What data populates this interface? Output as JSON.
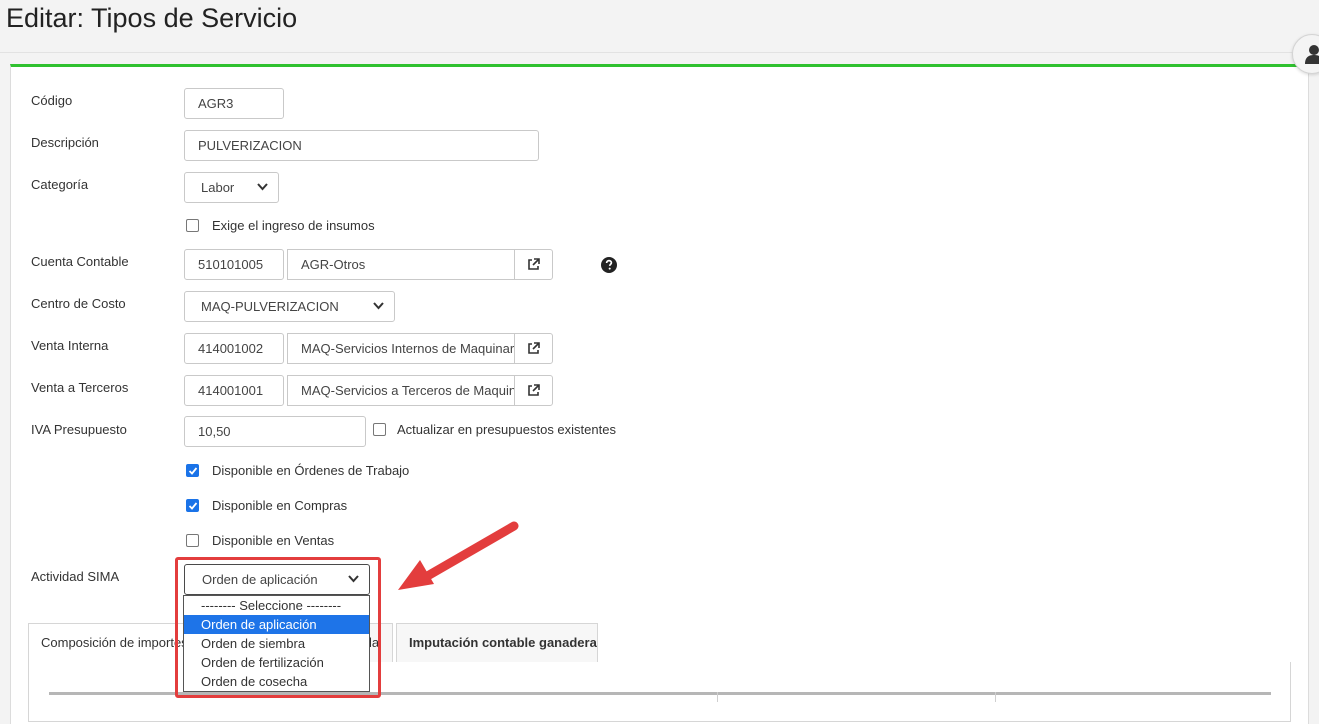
{
  "page": {
    "title": "Editar: Tipos de Servicio"
  },
  "form": {
    "codigo": {
      "label": "Código",
      "value": "AGR3"
    },
    "descripcion": {
      "label": "Descripción",
      "value": "PULVERIZACION"
    },
    "categoria": {
      "label": "Categoría",
      "value": "Labor"
    },
    "exige_insumos": {
      "label": "Exige el ingreso de insumos",
      "checked": false
    },
    "cuenta_contable": {
      "label": "Cuenta Contable",
      "code": "510101005",
      "name": "AGR-Otros"
    },
    "centro_costo": {
      "label": "Centro de Costo",
      "value": "MAQ-PULVERIZACION"
    },
    "venta_interna": {
      "label": "Venta Interna",
      "code": "414001002",
      "name": "MAQ-Servicios Internos de Maquinaria"
    },
    "venta_terceros": {
      "label": "Venta a Terceros",
      "code": "414001001",
      "name": "MAQ-Servicios a Terceros de Maquinaria"
    },
    "iva_presupuesto": {
      "label": "IVA Presupuesto",
      "value": "10,50"
    },
    "actualizar_presupuestos": {
      "label": "Actualizar en presupuestos existentes",
      "checked": false
    },
    "disponible_ordenes": {
      "label": "Disponible en Órdenes de Trabajo",
      "checked": true
    },
    "disponible_compras": {
      "label": "Disponible en Compras",
      "checked": true
    },
    "disponible_ventas": {
      "label": "Disponible en Ventas",
      "checked": false
    },
    "actividad_sima": {
      "label": "Actividad SIMA",
      "value": "Orden de aplicación",
      "options": [
        "-------- Seleccione --------",
        "Orden de aplicación",
        "Orden de siembra",
        "Orden de fertilización",
        "Orden de cosecha"
      ],
      "selected_index": 1
    }
  },
  "tabs": [
    {
      "label": "Composición de importes"
    },
    {
      "label": "la"
    },
    {
      "label": "Imputación contable ganadera"
    }
  ],
  "colors": {
    "accent": "#2fc12f",
    "highlight": "#e33d3d",
    "selection": "#1e74e8",
    "checkbox": "#1a73e8"
  },
  "icons": {
    "user": "user-circle-icon",
    "external": "external-link-icon",
    "help": "question-circle-icon",
    "caret": "chevron-down-icon"
  }
}
